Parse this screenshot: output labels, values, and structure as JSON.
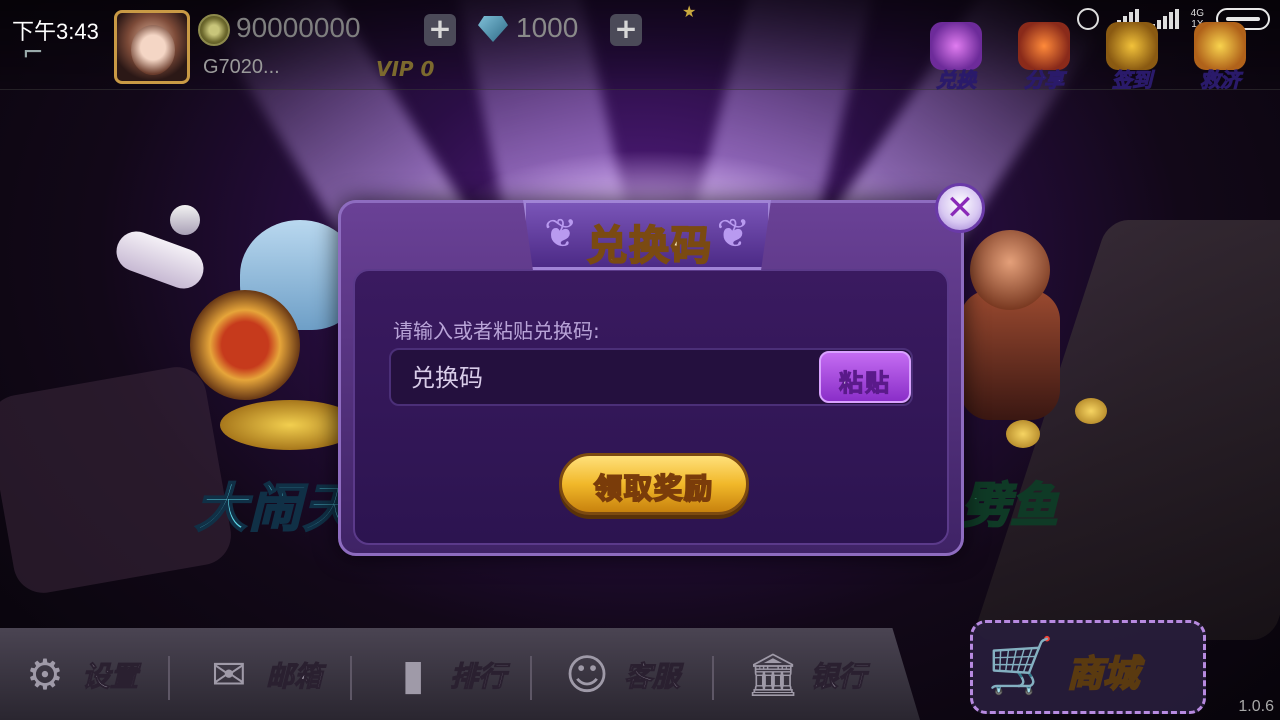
{
  "status_bar": {
    "time": "下午3:43",
    "network_label": "4G\n1X"
  },
  "header": {
    "coins": "90000000",
    "diamonds": "1000",
    "user_id": "G7020...",
    "vip_level": "VIP 0"
  },
  "top_actions": [
    {
      "label": "兑换",
      "icon": "gift-icon"
    },
    {
      "label": "分享",
      "icon": "share-icon"
    },
    {
      "label": "签到",
      "icon": "calendar-icon"
    },
    {
      "label": "救济",
      "icon": "treasure-icon"
    }
  ],
  "games": {
    "left_title": "大闹天",
    "right_title": "劈鱼"
  },
  "modal": {
    "title": "兑换码",
    "prompt": "请输入或者粘贴兑换码:",
    "input_placeholder": "兑换码",
    "paste_label": "粘贴",
    "claim_label": "领取奖励",
    "close_glyph": "✕"
  },
  "bottom_nav": [
    {
      "label": "设置",
      "icon": "gear-icon"
    },
    {
      "label": "邮箱",
      "icon": "mail-icon"
    },
    {
      "label": "排行",
      "icon": "ranking-icon"
    },
    {
      "label": "客服",
      "icon": "support-icon"
    },
    {
      "label": "银行",
      "icon": "bank-icon"
    }
  ],
  "shop_label": "商城",
  "version": "1.0.6",
  "colors": {
    "modal_bg": "#4f2b7a",
    "gold_button": "#f1b82a",
    "paste_button": "#a845dc"
  }
}
